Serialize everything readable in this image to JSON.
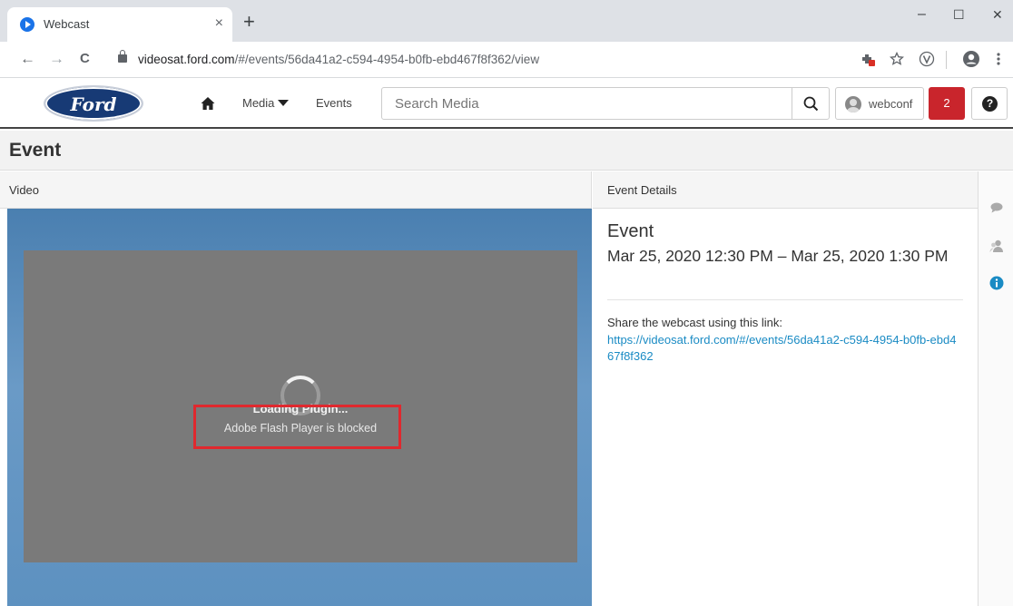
{
  "browser": {
    "tab_title": "Webcast",
    "tab_close": "×",
    "new_tab": "+",
    "window_controls": {
      "minimize": "–",
      "maximize": "☐",
      "close": "✕"
    },
    "url_host": "videosat.ford.com",
    "url_path": "/#/events/56da41a2-c594-4954-b0fb-ebd467f8f362/view",
    "nav_back": "←",
    "nav_forward": "→",
    "nav_reload": "C",
    "icons": [
      "extension-blocked-icon",
      "star-icon",
      "v-extension-icon",
      "profile-icon",
      "menu-icon"
    ]
  },
  "header": {
    "logo_text": "Ford",
    "nav": {
      "media": "Media",
      "events": "Events"
    },
    "search_placeholder": "Search Media",
    "user_name": "webconf",
    "notification_count": "2",
    "help_glyph": "?",
    "colors": {
      "brand_blue": "#173a75",
      "notification_red": "#c9252c"
    }
  },
  "page": {
    "title": "Event"
  },
  "video_panel": {
    "heading": "Video",
    "loading_text": "Loading Plugin...",
    "blocked_text": "Adobe Flash Player is blocked"
  },
  "details_panel": {
    "heading": "Event Details",
    "event_name": "Event",
    "event_time": "Mar 25, 2020 12:30 PM – Mar 25, 2020 1:30 PM",
    "share_label": "Share the webcast using this link:",
    "share_link": "https://videosat.ford.com/#/events/56da41a2-c594-4954-b0fb-ebd467f8f362",
    "link_color": "#1a8bc4"
  },
  "side_rail": {
    "icons": [
      "chat-icon",
      "users-icon",
      "info-icon"
    ]
  }
}
